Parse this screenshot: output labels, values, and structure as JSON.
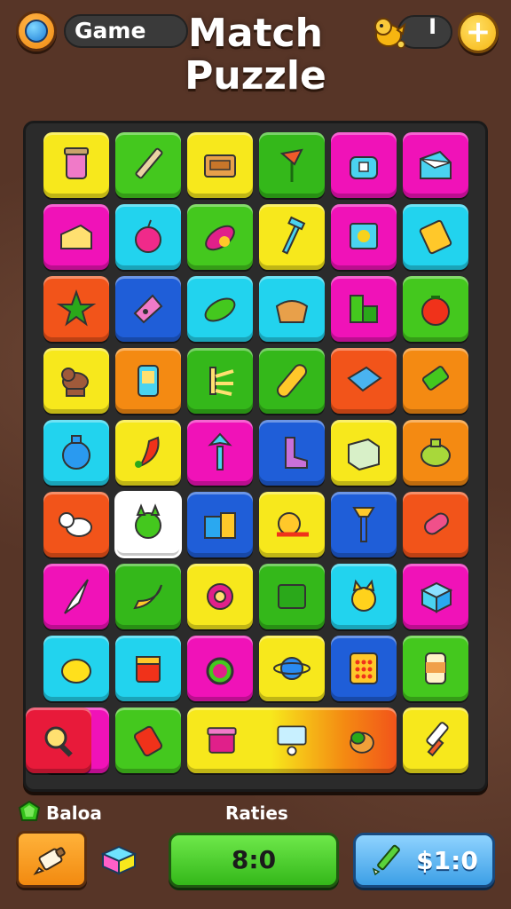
{
  "header": {
    "game_label": "Game",
    "title_line1": "Match",
    "title_line2": "Puzzle",
    "coin_count": "I",
    "add_label": "+"
  },
  "bottom": {
    "balance_label": "Baloa",
    "rates_label": "Raties",
    "score_value": "8:0",
    "buy_value": "$1:0"
  },
  "board": {
    "rows": [
      [
        {
          "color": "#f7e81c",
          "icon": "cup-icon"
        },
        {
          "color": "#44c81e",
          "icon": "pencil-icon"
        },
        {
          "color": "#f7e81c",
          "icon": "box-icon"
        },
        {
          "color": "#34b81a",
          "icon": "flower-icon"
        },
        {
          "color": "#f012b8",
          "icon": "bag-icon"
        },
        {
          "color": "#f012b8",
          "icon": "envelope-icon"
        }
      ],
      [
        {
          "color": "#f012b8",
          "icon": "cheese-icon"
        },
        {
          "color": "#22d3ee",
          "icon": "apple-icon"
        },
        {
          "color": "#44c81e",
          "icon": "leaf-icon"
        },
        {
          "color": "#f7e81c",
          "icon": "hammer-icon"
        },
        {
          "color": "#f012b8",
          "icon": "picture-icon"
        },
        {
          "color": "#22d3ee",
          "icon": "book-icon"
        }
      ],
      [
        {
          "color": "#f2541a",
          "icon": "star-plant-icon"
        },
        {
          "color": "#1f5ed8",
          "icon": "gem-icon"
        },
        {
          "color": "#22d3ee",
          "icon": "pepper-icon"
        },
        {
          "color": "#22d3ee",
          "icon": "basket-icon"
        },
        {
          "color": "#f012b8",
          "icon": "blocks-icon"
        },
        {
          "color": "#44c81e",
          "icon": "tomato-icon"
        }
      ],
      [
        {
          "color": "#f7e81c",
          "icon": "dog-icon"
        },
        {
          "color": "#f48a12",
          "icon": "phone-icon"
        },
        {
          "color": "#34b81a",
          "icon": "fern-icon"
        },
        {
          "color": "#34b81a",
          "icon": "bread-icon"
        },
        {
          "color": "#f2541a",
          "icon": "notebook-icon"
        },
        {
          "color": "#f48a12",
          "icon": "eraser-icon"
        }
      ],
      [
        {
          "color": "#22d3ee",
          "icon": "vase-icon"
        },
        {
          "color": "#f7e81c",
          "icon": "chili-icon"
        },
        {
          "color": "#f012b8",
          "icon": "palm-icon"
        },
        {
          "color": "#1f5ed8",
          "icon": "boot-icon"
        },
        {
          "color": "#f7e81c",
          "icon": "map-icon"
        },
        {
          "color": "#f48a12",
          "icon": "pot-icon"
        }
      ],
      [
        {
          "color": "#f2541a",
          "icon": "lamb-icon"
        },
        {
          "color": "#ffffff",
          "icon": "cat-icon",
          "selected": true
        },
        {
          "color": "#1f5ed8",
          "icon": "suitcase-icon"
        },
        {
          "color": "#f7e81c",
          "icon": "snail-icon"
        },
        {
          "color": "#1f5ed8",
          "icon": "brush-icon"
        },
        {
          "color": "#f2541a",
          "icon": "candy-icon"
        }
      ],
      [
        {
          "color": "#f012b8",
          "icon": "kite-icon"
        },
        {
          "color": "#34b81a",
          "icon": "banana-icon"
        },
        {
          "color": "#f7e81c",
          "icon": "ring-icon"
        },
        {
          "color": "#34b81a",
          "icon": "card-icon"
        },
        {
          "color": "#22d3ee",
          "icon": "kitten-icon"
        },
        {
          "color": "#f012b8",
          "icon": "cube-icon"
        }
      ],
      [
        {
          "color": "#22d3ee",
          "icon": "lemon-icon"
        },
        {
          "color": "#22d3ee",
          "icon": "juice-icon"
        },
        {
          "color": "#f012b8",
          "icon": "mirror-icon"
        },
        {
          "color": "#f7e81c",
          "icon": "planet-icon"
        },
        {
          "color": "#1f5ed8",
          "icon": "calculator-icon"
        },
        {
          "color": "#44c81e",
          "icon": "can-icon"
        }
      ],
      [
        {
          "color": "#f012b8",
          "icon": "note-icon"
        },
        {
          "color": "#44c81e",
          "icon": "scroll-icon"
        },
        {
          "color": "#f7e81c",
          "icon": "gift-icon",
          "wide": true,
          "icons": [
            "gift-icon",
            "monitor-icon",
            "fruit-icon"
          ]
        },
        {
          "color": "#f7e81c",
          "icon": "sword-icon"
        },
        {
          "color": "#e81a3a",
          "icon": "magnifier-icon"
        }
      ]
    ]
  }
}
